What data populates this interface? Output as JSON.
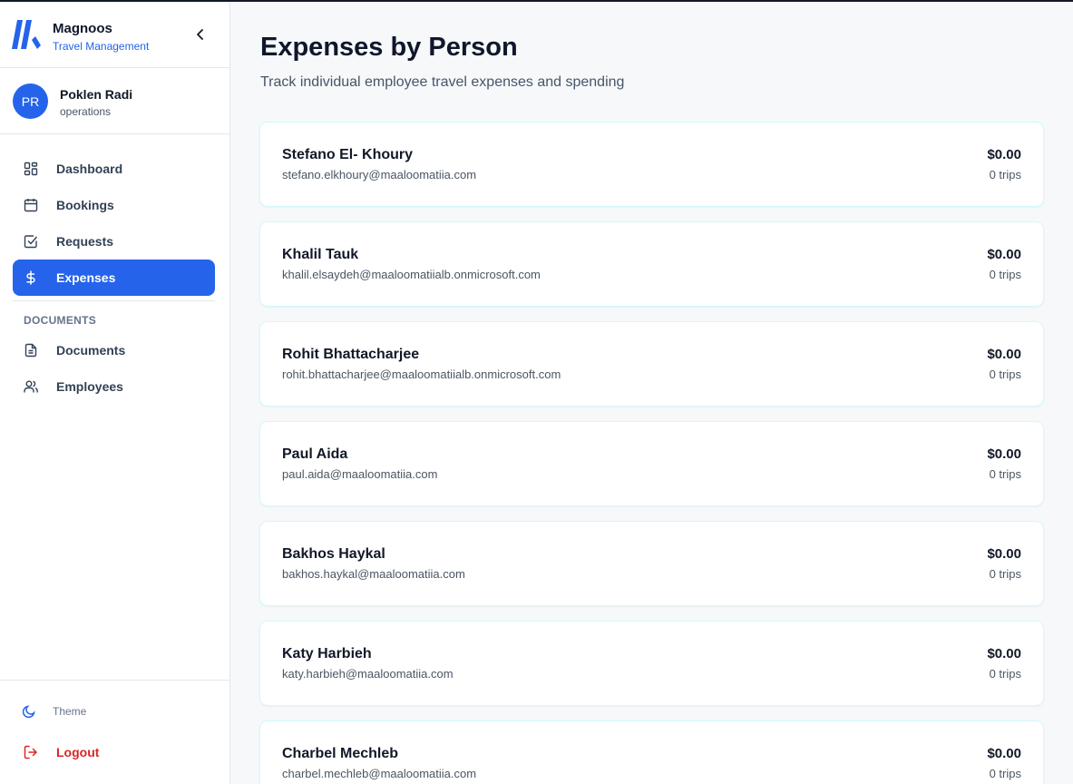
{
  "brand": {
    "name": "Magnoos",
    "subtitle": "Travel Management",
    "logo_icon": "brand-logo-icon"
  },
  "user": {
    "initials": "PR",
    "name": "Poklen Radi",
    "role": "operations"
  },
  "nav": {
    "items": [
      {
        "label": "Dashboard",
        "icon": "dashboard-icon"
      },
      {
        "label": "Bookings",
        "icon": "calendar-icon"
      },
      {
        "label": "Requests",
        "icon": "checkbox-icon"
      },
      {
        "label": "Expenses",
        "icon": "dollar-icon",
        "active": true
      }
    ],
    "section_label": "DOCUMENTS",
    "doc_items": [
      {
        "label": "Documents",
        "icon": "file-icon"
      },
      {
        "label": "Employees",
        "icon": "users-icon"
      }
    ]
  },
  "footer": {
    "theme_label": "Theme",
    "logout_label": "Logout"
  },
  "page": {
    "title": "Expenses by Person",
    "subtitle": "Track individual employee travel expenses and spending"
  },
  "people": [
    {
      "name": "Stefano El- Khoury",
      "email": "stefano.elkhoury@maaloomatiia.com",
      "amount": "$0.00",
      "trips": "0 trips"
    },
    {
      "name": "Khalil Tauk",
      "email": "khalil.elsaydeh@maaloomatiialb.onmicrosoft.com",
      "amount": "$0.00",
      "trips": "0 trips"
    },
    {
      "name": "Rohit Bhattacharjee",
      "email": "rohit.bhattacharjee@maaloomatiialb.onmicrosoft.com",
      "amount": "$0.00",
      "trips": "0 trips"
    },
    {
      "name": "Paul Aida",
      "email": "paul.aida@maaloomatiia.com",
      "amount": "$0.00",
      "trips": "0 trips"
    },
    {
      "name": "Bakhos Haykal",
      "email": "bakhos.haykal@maaloomatiia.com",
      "amount": "$0.00",
      "trips": "0 trips"
    },
    {
      "name": "Katy Harbieh",
      "email": "katy.harbieh@maaloomatiia.com",
      "amount": "$0.00",
      "trips": "0 trips"
    },
    {
      "name": "Charbel Mechleb",
      "email": "charbel.mechleb@maaloomatiia.com",
      "amount": "$0.00",
      "trips": "0 trips"
    }
  ],
  "colors": {
    "accent": "#2563eb",
    "danger": "#dc2626",
    "card_border": "#cffafe"
  }
}
